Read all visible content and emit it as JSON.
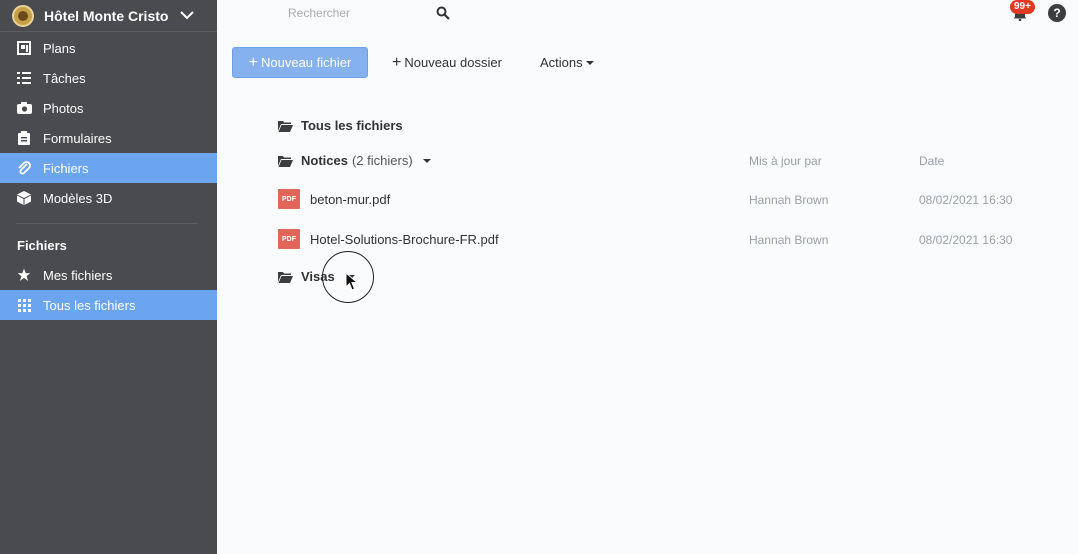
{
  "project": {
    "name": "Hôtel Monte Cristo"
  },
  "sidebar": {
    "items": [
      {
        "label": "Plans",
        "icon": "plans-icon"
      },
      {
        "label": "Tâches",
        "icon": "list-icon"
      },
      {
        "label": "Photos",
        "icon": "camera-icon"
      },
      {
        "label": "Formulaires",
        "icon": "clipboard-icon"
      },
      {
        "label": "Fichiers",
        "icon": "paperclip-icon",
        "active": true
      },
      {
        "label": "Modèles 3D",
        "icon": "cube-icon"
      }
    ],
    "section_title": "Fichiers",
    "file_items": [
      {
        "label": "Mes fichiers",
        "icon": "star-icon"
      },
      {
        "label": "Tous les fichiers",
        "icon": "grid-icon",
        "active": true
      }
    ]
  },
  "topbar": {
    "search_placeholder": "Rechercher",
    "notifications_badge": "99+",
    "help_label": "?"
  },
  "toolbar": {
    "new_file_label": "Nouveau fichier",
    "new_folder_label": "Nouveau dossier",
    "actions_label": "Actions"
  },
  "files": {
    "root_label": "Tous les fichiers",
    "folders": [
      {
        "name": "Notices",
        "count_label": "(2 fichiers)"
      },
      {
        "name": "Visas"
      }
    ],
    "columns": {
      "updated_by": "Mis à jour par",
      "date": "Date"
    },
    "rows": [
      {
        "name": "beton-mur.pdf",
        "type": "PDF",
        "updated_by": "Hannah Brown",
        "date": "08/02/2021 16:30"
      },
      {
        "name": "Hotel-Solutions-Brochure-FR.pdf",
        "type": "PDF",
        "updated_by": "Hannah Brown",
        "date": "08/02/2021 16:30"
      }
    ]
  },
  "colors": {
    "sidebar_bg": "#4a4b4f",
    "accent": "#6ba5ef",
    "pdf": "#e2655a",
    "badge": "#e03a22"
  }
}
